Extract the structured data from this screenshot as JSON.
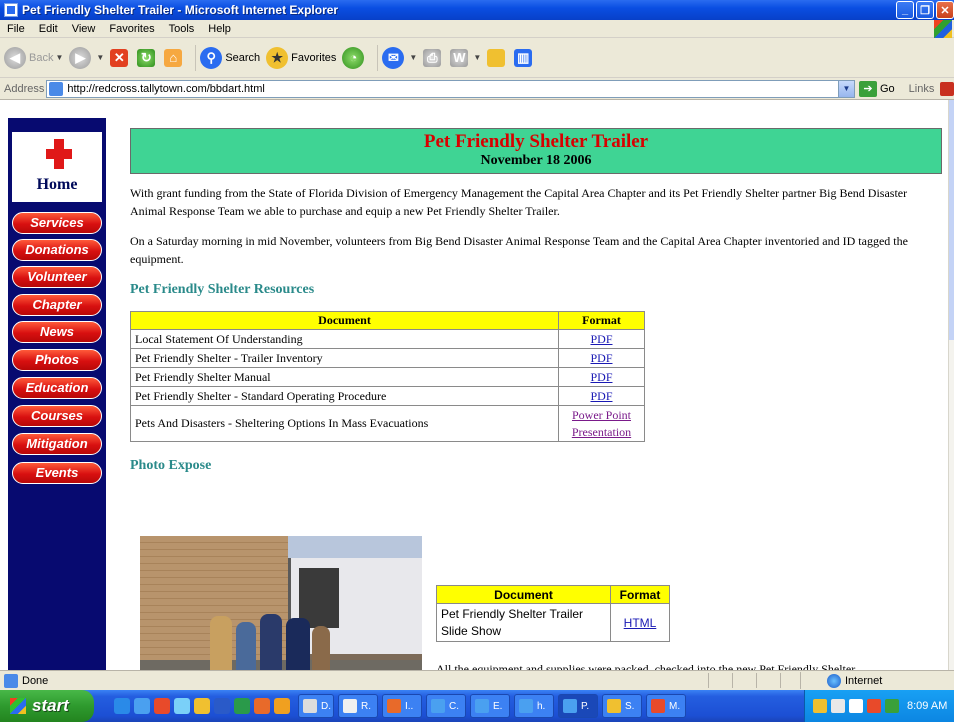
{
  "window": {
    "title": "Pet Friendly Shelter Trailer - Microsoft Internet Explorer"
  },
  "menu": [
    "File",
    "Edit",
    "View",
    "Favorites",
    "Tools",
    "Help"
  ],
  "toolbar": {
    "back": "Back",
    "search": "Search",
    "favorites": "Favorites"
  },
  "address": {
    "label": "Address",
    "url": "http://redcross.tallytown.com/bbdart.html",
    "go": "Go",
    "links": "Links"
  },
  "nav": {
    "home": "Home",
    "items": [
      "Services",
      "Donations",
      "Volunteer",
      "Chapter",
      "News",
      "Photos",
      "Education",
      "Courses",
      "Mitigation",
      "Events"
    ]
  },
  "page": {
    "title": "Pet Friendly Shelter Trailer",
    "date": "November 18 2006",
    "para1": "With grant funding from the State of Florida Division of Emergency Management the Capital Area Chapter and its Pet Friendly Shelter partner Big Bend Disaster Animal Response Team we able to purchase and equip a new Pet Friendly Shelter Trailer.",
    "para2": "On a Saturday morning in mid November, volunteers from Big Bend Disaster Animal Response Team and the Capital Area Chapter inventoried and ID tagged the equipment.",
    "resources_heading": "Pet Friendly Shelter Resources",
    "photo_heading": "Photo Expose",
    "trailing_text": "All the equipment and supplies were packed, checked into the new Pet Friendly Shelter"
  },
  "resources_table": {
    "headers": [
      "Document",
      "Format"
    ],
    "rows": [
      {
        "doc": "Local Statement Of Understanding",
        "format": "PDF"
      },
      {
        "doc": "Pet Friendly Shelter - Trailer Inventory",
        "format": "PDF"
      },
      {
        "doc": "Pet Friendly Shelter Manual",
        "format": "PDF"
      },
      {
        "doc": "Pet Friendly Shelter - Standard Operating Procedure",
        "format": "PDF"
      },
      {
        "doc": "Pets And Disasters - Sheltering Options In Mass Evacuations",
        "format1": "Power Point",
        "format2": "Presentation"
      }
    ]
  },
  "slideshow_table": {
    "headers": [
      "Document",
      "Format"
    ],
    "doc_line1": "Pet Friendly Shelter Trailer",
    "doc_line2": "Slide Show",
    "format": "HTML"
  },
  "status": {
    "text": "Done",
    "zone": "Internet"
  },
  "taskbar": {
    "start": "start",
    "tasks": [
      "D.",
      "R.",
      "I..",
      "C.",
      "E.",
      "h.",
      "P.",
      "S.",
      "M."
    ],
    "clock": "8:09 AM"
  },
  "colors": {
    "nav_bg": "#070a70",
    "header_green": "#3fd494",
    "title_red": "#d80000",
    "section_teal": "#2a8a8a",
    "table_header_yellow": "#ffff00"
  }
}
